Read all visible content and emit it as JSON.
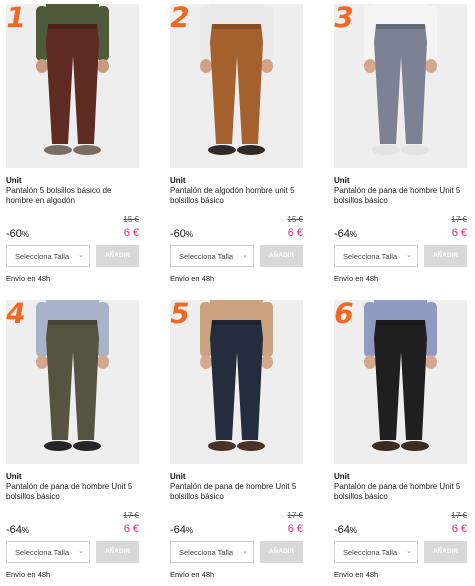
{
  "products": [
    {
      "rank": "1",
      "brand": "Unit",
      "title": "Pantalón 5 bolsillos básico de hombre en algodón",
      "old_price": "15 €",
      "discount": "-60",
      "discount_unit": "%",
      "price": "6 €",
      "select_label": "Selecciona Talla",
      "add_label": "AÑADIR",
      "shipping": "Envío en 48h",
      "pant_color": "#5e2a22",
      "shoe_color": "#7a6c62",
      "shirt_color": "#4f5a3a",
      "skin": "#c89a7e"
    },
    {
      "rank": "2",
      "brand": "Unit",
      "title": "Pantalón de algodón hombre unit 5 bolsillos básico",
      "old_price": "15 €",
      "discount": "-60",
      "discount_unit": "%",
      "price": "6 €",
      "select_label": "Selecciona Talla",
      "add_label": "AÑADIR",
      "shipping": "Envío en 48h",
      "pant_color": "#a4612e",
      "shoe_color": "#2f2a26",
      "shirt_color": "#e9e9e9",
      "skin": "#d2a284"
    },
    {
      "rank": "3",
      "brand": "Unit",
      "title": "Pantalón de pana de hombre Unit 5 bolsillos básico",
      "old_price": "17 €",
      "discount": "-64",
      "discount_unit": "%",
      "price": "6 €",
      "select_label": "Selecciona Talla",
      "add_label": "AÑADIR",
      "shipping": "Envío en 48h",
      "pant_color": "#7c8293",
      "shoe_color": "#e3e3e3",
      "shirt_color": "#f4f4f4",
      "skin": "#d4a88c"
    },
    {
      "rank": "4",
      "brand": "Unit",
      "title": "Pantalón de pana de hombre Unit 5 bolsillos básico",
      "old_price": "17 €",
      "discount": "-64",
      "discount_unit": "%",
      "price": "6 €",
      "select_label": "Selecciona Talla",
      "add_label": "AÑADIR",
      "shipping": "Envío en 48h",
      "pant_color": "#565341",
      "shoe_color": "#262626",
      "shirt_color": "#a6b3c9",
      "skin": "#d4a88c"
    },
    {
      "rank": "5",
      "brand": "Unit",
      "title": "Pantalón de pana de hombre Unit 5 bolsillos básico",
      "old_price": "17 €",
      "discount": "-64",
      "discount_unit": "%",
      "price": "6 €",
      "select_label": "Selecciona Talla",
      "add_label": "AÑADIR",
      "shipping": "Envío en 48h",
      "pant_color": "#252c3d",
      "shoe_color": "#4a3326",
      "shirt_color": "#c9a27f",
      "skin": "#d4a88c"
    },
    {
      "rank": "6",
      "brand": "Unit",
      "title": "Pantalón de pana de hombre Unit 5 bolsillos básico",
      "old_price": "17 €",
      "discount": "-64",
      "discount_unit": "%",
      "price": "6 €",
      "select_label": "Selecciona Talla",
      "add_label": "AÑADIR",
      "shipping": "Envío en 48h",
      "pant_color": "#1f1f1f",
      "shoe_color": "#3b2c22",
      "shirt_color": "#8e9ac0",
      "skin": "#d4a88c"
    }
  ]
}
